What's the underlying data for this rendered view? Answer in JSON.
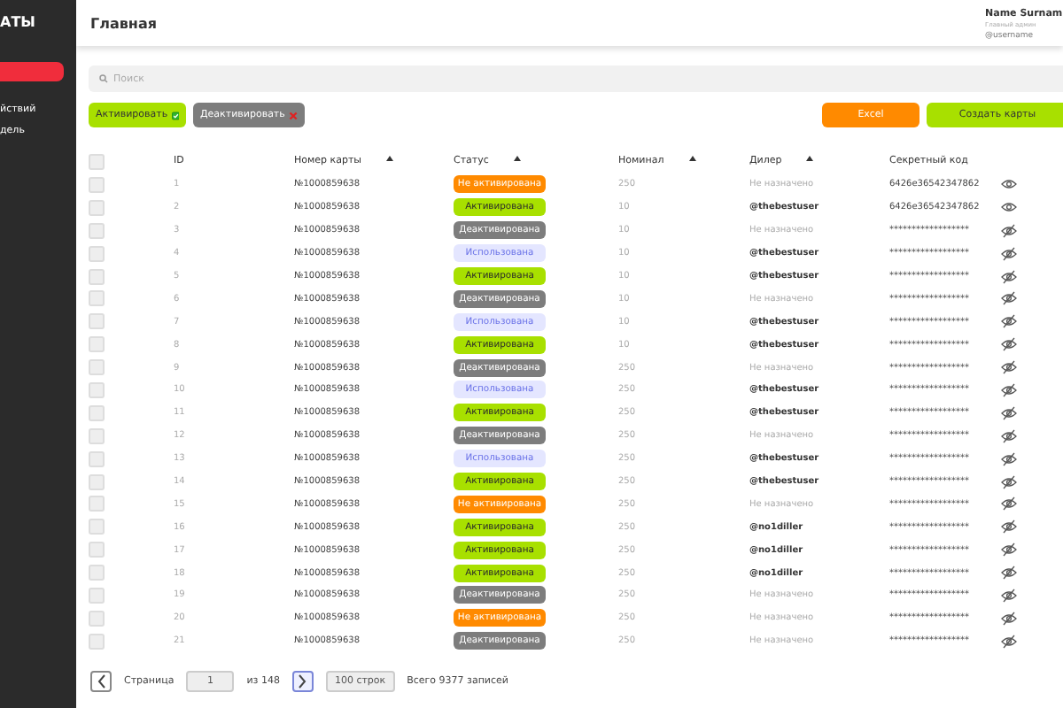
{
  "sidebar": {
    "logo": "АТЫ",
    "items": [
      {
        "label": "йствий"
      },
      {
        "label": "дель"
      }
    ]
  },
  "header": {
    "title": "Главная",
    "user": {
      "name": "Name Surnam",
      "role": "Главный админ",
      "username": "@username"
    }
  },
  "search": {
    "placeholder": "Поиск"
  },
  "actions": {
    "activate": "Активировать",
    "deactivate": "Деактивировать",
    "excel": "Excel",
    "create": "Создать карты"
  },
  "table": {
    "select_all": false,
    "columns": [
      {
        "label": "ID",
        "sortable": false
      },
      {
        "label": "Номер карты",
        "sortable": true
      },
      {
        "label": "Статус",
        "sortable": true
      },
      {
        "label": "Номинал",
        "sortable": true
      },
      {
        "label": "Дилер",
        "sortable": true
      },
      {
        "label": "Секретный код",
        "sortable": false
      }
    ],
    "rows": [
      {
        "checked": false,
        "id": "1",
        "card": "№1000859638",
        "status": {
          "label": "Не активирована",
          "kind": "not_activated"
        },
        "nominal": "250",
        "dealer": {
          "text": "Не назначено",
          "assigned": false
        },
        "secret": "6426e36542347862",
        "revealed": true
      },
      {
        "checked": false,
        "id": "2",
        "card": "№1000859638",
        "status": {
          "label": "Активирована",
          "kind": "activated"
        },
        "nominal": "10",
        "dealer": {
          "text": "@thebestuser",
          "assigned": true
        },
        "secret": "6426e36542347862",
        "revealed": true
      },
      {
        "checked": false,
        "id": "3",
        "card": "№1000859638",
        "status": {
          "label": "Деактивирована",
          "kind": "deactivated"
        },
        "nominal": "10",
        "dealer": {
          "text": "Не назначено",
          "assigned": false
        },
        "secret": "******************",
        "revealed": false
      },
      {
        "checked": false,
        "id": "4",
        "card": "№1000859638",
        "status": {
          "label": "Использована",
          "kind": "used"
        },
        "nominal": "10",
        "dealer": {
          "text": "@thebestuser",
          "assigned": true
        },
        "secret": "******************",
        "revealed": false
      },
      {
        "checked": false,
        "id": "5",
        "card": "№1000859638",
        "status": {
          "label": "Активирована",
          "kind": "activated"
        },
        "nominal": "10",
        "dealer": {
          "text": "@thebestuser",
          "assigned": true
        },
        "secret": "******************",
        "revealed": false
      },
      {
        "checked": false,
        "id": "6",
        "card": "№1000859638",
        "status": {
          "label": "Деактивирована",
          "kind": "deactivated"
        },
        "nominal": "10",
        "dealer": {
          "text": "Не назначено",
          "assigned": false
        },
        "secret": "******************",
        "revealed": false
      },
      {
        "checked": false,
        "id": "7",
        "card": "№1000859638",
        "status": {
          "label": "Использована",
          "kind": "used"
        },
        "nominal": "10",
        "dealer": {
          "text": "@thebestuser",
          "assigned": true
        },
        "secret": "******************",
        "revealed": false
      },
      {
        "checked": false,
        "id": "8",
        "card": "№1000859638",
        "status": {
          "label": "Активирована",
          "kind": "activated"
        },
        "nominal": "10",
        "dealer": {
          "text": "@thebestuser",
          "assigned": true
        },
        "secret": "******************",
        "revealed": false
      },
      {
        "checked": false,
        "id": "9",
        "card": "№1000859638",
        "status": {
          "label": "Деактивирована",
          "kind": "deactivated"
        },
        "nominal": "250",
        "dealer": {
          "text": "Не назначено",
          "assigned": false
        },
        "secret": "******************",
        "revealed": false
      },
      {
        "checked": false,
        "id": "10",
        "card": "№1000859638",
        "status": {
          "label": "Использована",
          "kind": "used"
        },
        "nominal": "250",
        "dealer": {
          "text": "@thebestuser",
          "assigned": true
        },
        "secret": "******************",
        "revealed": false
      },
      {
        "checked": false,
        "id": "11",
        "card": "№1000859638",
        "status": {
          "label": "Активирована",
          "kind": "activated"
        },
        "nominal": "250",
        "dealer": {
          "text": "@thebestuser",
          "assigned": true
        },
        "secret": "******************",
        "revealed": false
      },
      {
        "checked": false,
        "id": "12",
        "card": "№1000859638",
        "status": {
          "label": "Деактивирована",
          "kind": "deactivated"
        },
        "nominal": "250",
        "dealer": {
          "text": "Не назначено",
          "assigned": false
        },
        "secret": "******************",
        "revealed": false
      },
      {
        "checked": false,
        "id": "13",
        "card": "№1000859638",
        "status": {
          "label": "Использована",
          "kind": "used"
        },
        "nominal": "250",
        "dealer": {
          "text": "@thebestuser",
          "assigned": true
        },
        "secret": "******************",
        "revealed": false
      },
      {
        "checked": false,
        "id": "14",
        "card": "№1000859638",
        "status": {
          "label": "Активирована",
          "kind": "activated"
        },
        "nominal": "250",
        "dealer": {
          "text": "@thebestuser",
          "assigned": true
        },
        "secret": "******************",
        "revealed": false
      },
      {
        "checked": false,
        "id": "15",
        "card": "№1000859638",
        "status": {
          "label": "Не активирована",
          "kind": "not_activated"
        },
        "nominal": "250",
        "dealer": {
          "text": "Не назначено",
          "assigned": false
        },
        "secret": "******************",
        "revealed": false
      },
      {
        "checked": false,
        "id": "16",
        "card": "№1000859638",
        "status": {
          "label": "Активирована",
          "kind": "activated"
        },
        "nominal": "250",
        "dealer": {
          "text": "@no1diller",
          "assigned": true
        },
        "secret": "******************",
        "revealed": false
      },
      {
        "checked": false,
        "id": "17",
        "card": "№1000859638",
        "status": {
          "label": "Активирована",
          "kind": "activated"
        },
        "nominal": "250",
        "dealer": {
          "text": "@no1diller",
          "assigned": true
        },
        "secret": "******************",
        "revealed": false
      },
      {
        "checked": false,
        "id": "18",
        "card": "№1000859638",
        "status": {
          "label": "Активирована",
          "kind": "activated"
        },
        "nominal": "250",
        "dealer": {
          "text": "@no1diller",
          "assigned": true
        },
        "secret": "******************",
        "revealed": false
      },
      {
        "checked": false,
        "id": "19",
        "card": "№1000859638",
        "status": {
          "label": "Деактивирована",
          "kind": "deactivated"
        },
        "nominal": "250",
        "dealer": {
          "text": "Не назначено",
          "assigned": false
        },
        "secret": "******************",
        "revealed": false
      },
      {
        "checked": false,
        "id": "20",
        "card": "№1000859638",
        "status": {
          "label": "Не активирована",
          "kind": "not_activated"
        },
        "nominal": "250",
        "dealer": {
          "text": "Не назначено",
          "assigned": false
        },
        "secret": "******************",
        "revealed": false
      },
      {
        "checked": false,
        "id": "21",
        "card": "№1000859638",
        "status": {
          "label": "Деактивирована",
          "kind": "deactivated"
        },
        "nominal": "250",
        "dealer": {
          "text": "Не назначено",
          "assigned": false
        },
        "secret": "******************",
        "revealed": false
      }
    ]
  },
  "pagination": {
    "page_label": "Страница",
    "page": "1",
    "of": "из 148",
    "per_page": "100 строк",
    "total": "Всего 9377 записей"
  }
}
